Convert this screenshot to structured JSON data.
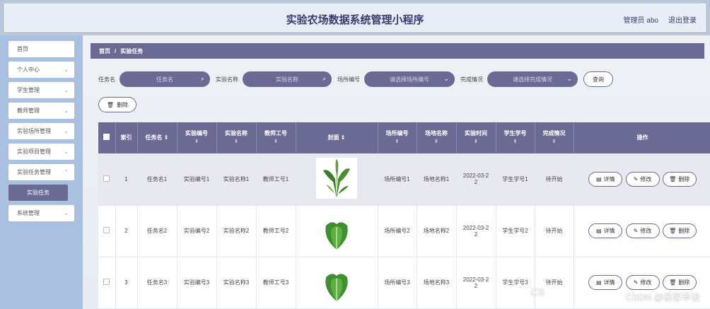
{
  "header": {
    "title": "实验农场数据系统管理小程序",
    "user": "管理员 abo",
    "logout": "退出登录"
  },
  "sidebar": {
    "items": [
      {
        "label": "首页",
        "chev": false
      },
      {
        "label": "个人中心",
        "chev": true
      },
      {
        "label": "学生管理",
        "chev": true
      },
      {
        "label": "教师管理",
        "chev": true
      },
      {
        "label": "实验场所管理",
        "chev": true
      },
      {
        "label": "实验项目管理",
        "chev": true
      },
      {
        "label": "实验任务管理",
        "chev": true
      }
    ],
    "active_sub": "实验任务",
    "last_item": "系统管理"
  },
  "breadcrumb": {
    "home": "首页",
    "sep": "/",
    "current": "实验任务"
  },
  "search": {
    "fields": [
      {
        "label": "任务名",
        "placeholder": "任务名",
        "icon": "search-icon"
      },
      {
        "label": "实验名称",
        "placeholder": "实验名称",
        "icon": "search-icon"
      },
      {
        "label": "场所编号",
        "placeholder": "请选择场所编号",
        "icon": "chevron-down-icon"
      },
      {
        "label": "完成情况",
        "placeholder": "请选择完成情况",
        "icon": "chevron-down-icon"
      }
    ],
    "query_button": "查询",
    "delete_button": "删除"
  },
  "table": {
    "headers": [
      "索引",
      "任务名",
      "实验编号",
      "实验名称",
      "教师工号",
      "封面",
      "场所编号",
      "场地名称",
      "实验时间",
      "学生学号",
      "完成情况",
      "操作"
    ],
    "rows": [
      {
        "index": "1",
        "task": "任务名1",
        "exp_no": "实验编号1",
        "exp_name": "实验名称1",
        "teacher": "教师工号1",
        "place_no": "场所编号1",
        "place_name": "场地名称1",
        "time_a": "2022-03-2",
        "time_b": "2",
        "student": "学生学号1",
        "status": "待开始"
      },
      {
        "index": "2",
        "task": "任务名2",
        "exp_no": "实验编号2",
        "exp_name": "实验名称2",
        "teacher": "教师工号2",
        "place_no": "场所编号2",
        "place_name": "场地名称2",
        "time_a": "2022-03-2",
        "time_b": "2",
        "student": "学生学号2",
        "status": "待开始"
      },
      {
        "index": "3",
        "task": "任务名3",
        "exp_no": "实验编号3",
        "exp_name": "实验名称3",
        "teacher": "教师工号3",
        "place_no": "场所编号3",
        "place_name": "场地名称3",
        "time_a": "2022-03-2",
        "time_b": "2",
        "student": "学生学号3",
        "status": "待开始"
      }
    ],
    "actions": {
      "detail": "详情",
      "edit": "修改",
      "delete": "删除"
    }
  },
  "watermark": {
    "cs": "CS",
    "text": "CSDN @极客毕设"
  },
  "colors": {
    "accent": "#6b6a94",
    "sidebar": "#a9c0e0",
    "header": "#b9c6db"
  }
}
